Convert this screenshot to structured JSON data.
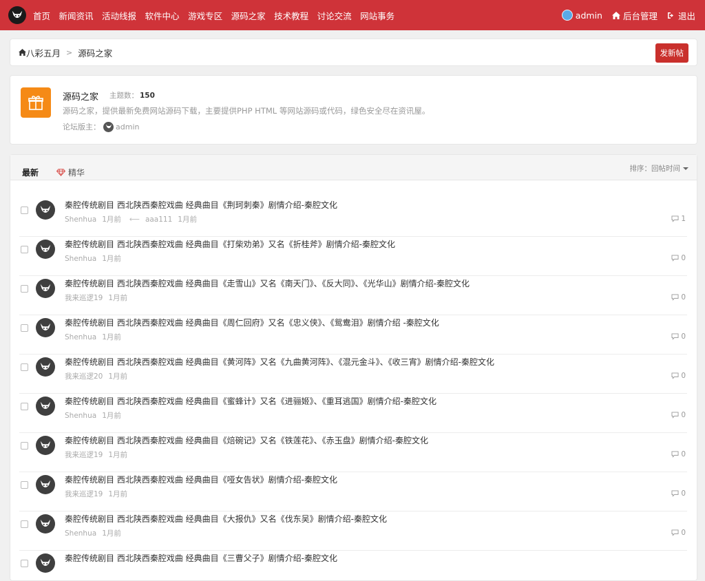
{
  "nav": {
    "links": [
      "首页",
      "新闻资讯",
      "活动线报",
      "软件中心",
      "游戏专区",
      "源码之家",
      "技术教程",
      "讨论交流",
      "网站事务"
    ],
    "user": "admin",
    "admin_panel": "后台管理",
    "logout": "退出"
  },
  "breadcrumb": {
    "home": "八彩五月",
    "separator": ">",
    "current": "源码之家",
    "new_post": "发新帖"
  },
  "forum": {
    "name": "源码之家",
    "topic_count_label": "主题数：",
    "topic_count": "150",
    "description": "源码之家，提供最新免费网站源码下载，主要提供PHP HTML 等网站源码或代码，绿色安全尽在资讯屋。",
    "moderator_label": "论坛版主：",
    "moderator": "admin"
  },
  "threadlist": {
    "tab_latest": "最新",
    "tab_digest": "精华",
    "sort_label": "排序：回帖时间"
  },
  "threads": [
    {
      "title": "秦腔传统剧目 西北陕西秦腔戏曲 经典曲目《荆珂刺秦》剧情介绍-秦腔文化",
      "author": "Shenhua",
      "time": "1月前",
      "last_user": "aaa111",
      "last_time": "1月前",
      "replies": "1"
    },
    {
      "title": "秦腔传统剧目 西北陕西秦腔戏曲 经典曲目《打柴劝弟》又名《折桂斧》剧情介绍-秦腔文化",
      "author": "Shenhua",
      "time": "1月前",
      "replies": "0"
    },
    {
      "title": "秦腔传统剧目 西北陕西秦腔戏曲 经典曲目《走雪山》又名《南天门》、《反大同》、《光华山》剧情介绍-秦腔文化",
      "author": "我来巡逻19",
      "time": "1月前",
      "replies": "0"
    },
    {
      "title": "秦腔传统剧目 西北陕西秦腔戏曲 经典曲目《周仁回府》又名《忠义侠》、《鸳鸯泪》剧情介绍 -秦腔文化",
      "author": "Shenhua",
      "time": "1月前",
      "replies": "0"
    },
    {
      "title": "秦腔传统剧目 西北陕西秦腔戏曲 经典曲目《黄河阵》又名《九曲黄河阵》、《混元金斗》、《收三宵》剧情介绍-秦腔文化",
      "author": "我来巡逻20",
      "time": "1月前",
      "replies": "0"
    },
    {
      "title": "秦腔传统剧目 西北陕西秦腔戏曲 经典曲目《蜜蜂计》又名《进骊姬》、《重耳逃国》剧情介绍-秦腔文化",
      "author": "Shenhua",
      "time": "1月前",
      "replies": "0"
    },
    {
      "title": "秦腔传统剧目 西北陕西秦腔戏曲 经典曲目《焙碗记》又名《铁莲花》、《赤玉盘》剧情介绍-秦腔文化",
      "author": "我来巡逻19",
      "time": "1月前",
      "replies": "0"
    },
    {
      "title": "秦腔传统剧目 西北陕西秦腔戏曲 经典曲目《哑女告状》剧情介绍-秦腔文化",
      "author": "我来巡逻19",
      "time": "1月前",
      "replies": "0"
    },
    {
      "title": "秦腔传统剧目 西北陕西秦腔戏曲 经典曲目《大报仇》又名《伐东吴》剧情介绍-秦腔文化",
      "author": "Shenhua",
      "time": "1月前",
      "replies": "0"
    },
    {
      "title": "秦腔传统剧目 西北陕西秦腔戏曲 经典曲目《三曹父子》剧情介绍-秦腔文化",
      "author": "",
      "time": "",
      "replies": ""
    }
  ]
}
